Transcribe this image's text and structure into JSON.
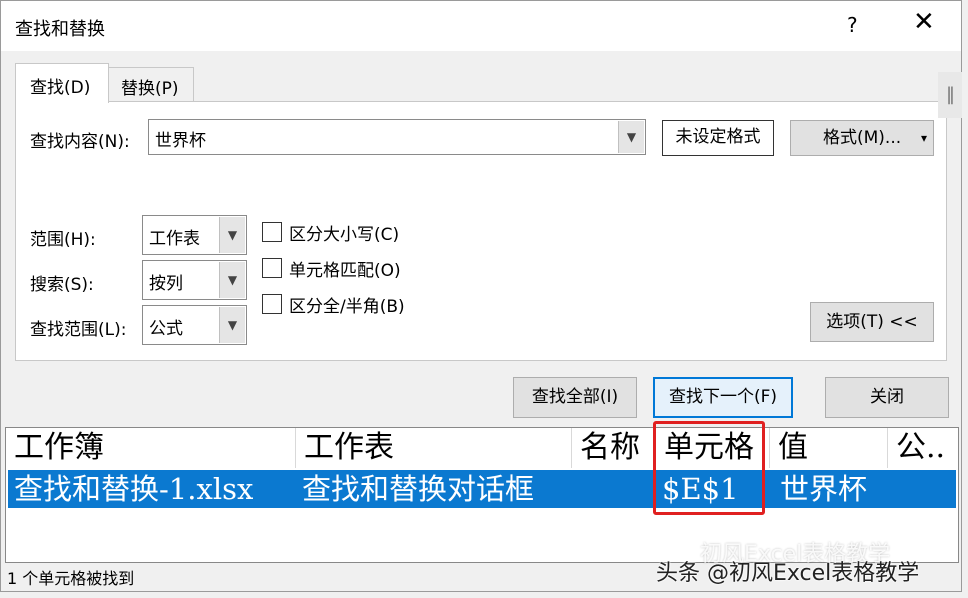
{
  "window": {
    "title": "查找和替换",
    "help_label": "?",
    "close_label": "✕"
  },
  "tabs": {
    "find": "查找(D)",
    "replace": "替换(P)"
  },
  "find": {
    "label": "查找内容(N):",
    "value": "世界杯",
    "no_format_label": "未设定格式",
    "format_button": "格式(M)...",
    "format_arrow": "▾"
  },
  "options": {
    "within_label": "范围(H):",
    "within_value": "工作表",
    "search_label": "搜索(S):",
    "search_value": "按列",
    "lookin_label": "查找范围(L):",
    "lookin_value": "公式",
    "match_case": "区分大小写(C)",
    "match_entire": "单元格匹配(O)",
    "match_byte": "区分全/半角(B)",
    "options_button": "选项(T) <<"
  },
  "buttons": {
    "find_all": "查找全部(I)",
    "find_next": "查找下一个(F)",
    "close": "关闭"
  },
  "results": {
    "columns": [
      "工作簿",
      "工作表",
      "名称",
      "单元格",
      "值",
      "公.."
    ],
    "rows": [
      {
        "workbook": "查找和替换-1.xlsx",
        "sheet": "查找和替换对话框",
        "name": "",
        "cell": "$E$1",
        "value": "世界杯",
        "formula": ""
      }
    ]
  },
  "status": "1 个单元格被找到",
  "scroll_glyph": "‖",
  "watermark": {
    "line1": "初风Excel表格教学",
    "line2": "头条 @初风Excel表格教学"
  },
  "colors": {
    "selection": "#0b79d0",
    "highlight_box": "#e02020"
  }
}
